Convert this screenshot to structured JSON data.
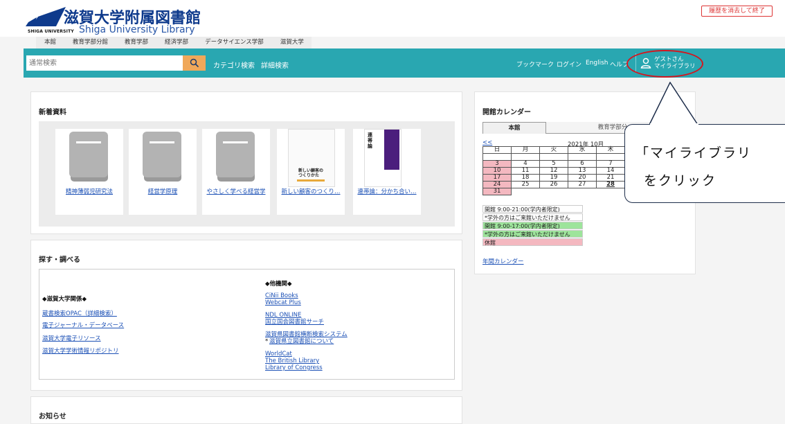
{
  "header": {
    "title_ja": "滋賀大学附属図書館",
    "title_en": "Shiga University Library",
    "uni_small": "SHIGA UNIVERSITY",
    "exit_button": "履歴を消去して終了"
  },
  "branch_tabs": [
    "本館",
    "教育学部分館",
    "教育学部",
    "経済学部",
    "データサイエンス学部",
    "滋賀大学"
  ],
  "nav": {
    "search_placeholder": "通常検索",
    "category_search": "カテゴリ検索",
    "advanced_search": "詳細検索",
    "bookmark": "ブックマーク",
    "login": "ログイン",
    "english": "English",
    "help": "ヘルプ",
    "guest": "ゲストさん",
    "my_library": "マイライブラリ"
  },
  "new_items": {
    "title": "新着資料",
    "books": [
      "精神薄弱児研究法",
      "経営学原理",
      "やさしく学べる経営学",
      "新しい顧客のつくり…",
      "連帯論：分かち合い…"
    ],
    "cover_text": [
      "新しい顧客の",
      "つくりかた",
      "連帯論"
    ]
  },
  "search_section": {
    "title": "探す・調べる",
    "left_heading": "◆滋賀大学関係◆",
    "left_links": [
      "蔵書検索OPAC（詳細検索）",
      "電子ジャーナル・データベース",
      "滋賀大学電子リソース",
      "滋賀大学学術情報リポジトリ"
    ],
    "right_heading": "◆他機関◆",
    "right_links": [
      "CiNii Books",
      "Webcat Plus",
      "NDL ONLINE",
      "国立国会図書館サーチ",
      "滋賀県図書館横断検索システム",
      "滋賀県立図書館について",
      "WorldCat",
      "The British Library",
      "Library of Congress"
    ],
    "asterisk": "*"
  },
  "news": {
    "title": "お知らせ"
  },
  "calendar": {
    "title": "開館カレンダー",
    "tabs": [
      "本館",
      "教育学部分"
    ],
    "prev": "<<",
    "month": "2021年 10月",
    "weekdays": [
      "日",
      "月",
      "火",
      "水",
      "木"
    ],
    "weeks": [
      [
        "",
        "",
        "",
        "",
        ""
      ],
      [
        "3",
        "4",
        "5",
        "6",
        "7"
      ],
      [
        "10",
        "11",
        "12",
        "13",
        "14"
      ],
      [
        "17",
        "18",
        "19",
        "20",
        "21"
      ],
      [
        "24",
        "25",
        "26",
        "27",
        "28"
      ],
      [
        "31",
        "",
        "",
        "",
        ""
      ]
    ],
    "legend": [
      "開館 9:00-21:00(学内者限定)",
      "*学外の方はご来館いただけません",
      "開館 9:00-17:00(学内者限定)",
      "*学外の方はご来館いただけません",
      "休館"
    ],
    "annual_link": "年間カレンダー",
    "colors": {
      "closed": "#f4b8c0",
      "short_hours": "#9de49b",
      "regular": "#ffffff"
    }
  },
  "callout": {
    "line1": "「マイライブラリ",
    "line2": "をクリック"
  },
  "colors": {
    "nav": "#29a7b1",
    "search_button": "#f0a85a",
    "highlight": "#d4161f"
  }
}
